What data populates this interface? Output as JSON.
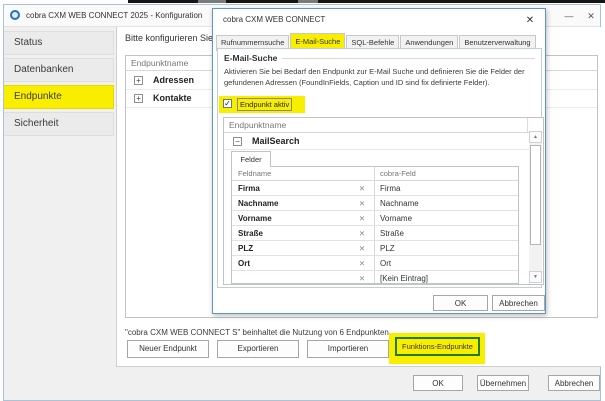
{
  "icons": {
    "close": "✕",
    "minimize": "—",
    "check": "✓",
    "plus": "+",
    "minus": "−",
    "remove": "✕",
    "arrow_up": "▲",
    "arrow_down": "▼"
  },
  "colors": {
    "highlight_yellow": "#f9ee00",
    "dialog_border": "#5a96c8",
    "function_button_border": "#1e7b1e"
  },
  "main_window": {
    "title": "cobra CXM WEB CONNECT  2025 - Konfiguration",
    "sidebar": {
      "items": [
        {
          "label": "Status"
        },
        {
          "label": "Datenbanken"
        },
        {
          "label": "Endpunkte"
        },
        {
          "label": "Sicherheit"
        }
      ],
      "active_item": "Endpunkte"
    },
    "content": {
      "instruction": "Bitte konfigurieren Sie die",
      "endpoint_table": {
        "header": "Endpunktname",
        "rows": [
          {
            "label": "Adressen"
          },
          {
            "label": "Kontakte"
          }
        ]
      },
      "license_note": "\"cobra CXM WEB CONNECT S\" beinhaltet die Nutzung von 6 Endpunkten.",
      "action_buttons": {
        "new": "Neuer Endpunkt",
        "export": "Exportieren",
        "import": "Importieren",
        "functions": "Funktions-Endpunkte"
      }
    },
    "footer_buttons": {
      "ok": "OK",
      "apply": "Übernehmen",
      "cancel": "Abbrechen"
    }
  },
  "dialog": {
    "title": "cobra CXM WEB CONNECT",
    "tabs": [
      {
        "label": "Rufnummernsuche"
      },
      {
        "label": "E-Mail-Suche"
      },
      {
        "label": "SQL-Befehle"
      },
      {
        "label": "Anwendungen"
      },
      {
        "label": "Benutzerverwaltung"
      }
    ],
    "active_tab": "E-Mail-Suche",
    "section": {
      "title": "E-Mail-Suche",
      "description_line1": "Aktivieren Sie bei Bedarf den Endpunkt zur E-Mail Suche und definieren Sie die Felder der",
      "description_line2": "gefundenen Adressen (FoundInFields, Caption und ID sind fix definierte Felder).",
      "checkbox_label": "Endpunkt aktiv",
      "checkbox_checked": true
    },
    "endpoint_table": {
      "header": "Endpunktname",
      "group_label": "MailSearch",
      "fields_tab_label": "Felder",
      "grid": {
        "columns": {
          "name": "Feldname",
          "cobra": "cobra-Feld"
        },
        "rows": [
          {
            "name": "Firma",
            "cobra": "Firma"
          },
          {
            "name": "Nachname",
            "cobra": "Nachname"
          },
          {
            "name": "Vorname",
            "cobra": "Vorname"
          },
          {
            "name": "Straße",
            "cobra": "Straße"
          },
          {
            "name": "PLZ",
            "cobra": "PLZ"
          },
          {
            "name": "Ort",
            "cobra": "Ort"
          }
        ],
        "partial_row": {
          "name": "",
          "cobra": "[Kein Eintrag]"
        }
      }
    },
    "footer_buttons": {
      "ok": "OK",
      "cancel": "Abbrechen"
    }
  }
}
